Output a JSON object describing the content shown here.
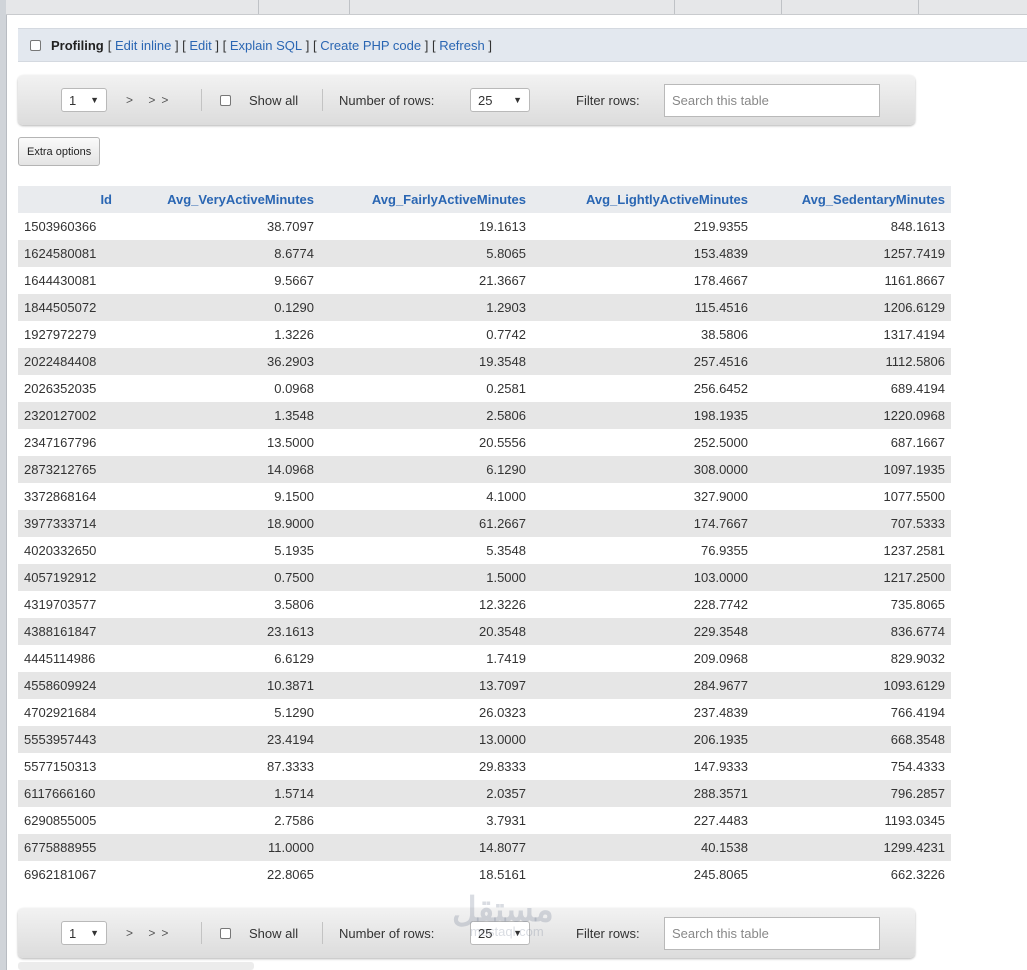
{
  "profiling": {
    "label": "Profiling",
    "links": [
      "Edit inline",
      "Edit",
      "Explain SQL",
      "Create PHP code",
      "Refresh"
    ]
  },
  "nav_top": {
    "page_value": "1",
    "arrows": "> >>",
    "show_all_label": "Show all",
    "rows_label": "Number of rows:",
    "rows_value": "25",
    "filter_label": "Filter rows:",
    "search_placeholder": "Search this table"
  },
  "nav_bottom": {
    "page_value": "1",
    "arrows": "> >>",
    "show_all_label": "Show all",
    "rows_label": "Number of rows:",
    "rows_value": "25",
    "filter_label": "Filter rows:",
    "search_placeholder": "Search this table"
  },
  "extra_options_label": "Extra options",
  "table": {
    "columns": [
      "Id",
      "Avg_VeryActiveMinutes",
      "Avg_FairlyActiveMinutes",
      "Avg_LightlyActiveMinutes",
      "Avg_SedentaryMinutes"
    ],
    "rows": [
      [
        "1503960366",
        "38.7097",
        "19.1613",
        "219.9355",
        "848.1613"
      ],
      [
        "1624580081",
        "8.6774",
        "5.8065",
        "153.4839",
        "1257.7419"
      ],
      [
        "1644430081",
        "9.5667",
        "21.3667",
        "178.4667",
        "1161.8667"
      ],
      [
        "1844505072",
        "0.1290",
        "1.2903",
        "115.4516",
        "1206.6129"
      ],
      [
        "1927972279",
        "1.3226",
        "0.7742",
        "38.5806",
        "1317.4194"
      ],
      [
        "2022484408",
        "36.2903",
        "19.3548",
        "257.4516",
        "1112.5806"
      ],
      [
        "2026352035",
        "0.0968",
        "0.2581",
        "256.6452",
        "689.4194"
      ],
      [
        "2320127002",
        "1.3548",
        "2.5806",
        "198.1935",
        "1220.0968"
      ],
      [
        "2347167796",
        "13.5000",
        "20.5556",
        "252.5000",
        "687.1667"
      ],
      [
        "2873212765",
        "14.0968",
        "6.1290",
        "308.0000",
        "1097.1935"
      ],
      [
        "3372868164",
        "9.1500",
        "4.1000",
        "327.9000",
        "1077.5500"
      ],
      [
        "3977333714",
        "18.9000",
        "61.2667",
        "174.7667",
        "707.5333"
      ],
      [
        "4020332650",
        "5.1935",
        "5.3548",
        "76.9355",
        "1237.2581"
      ],
      [
        "4057192912",
        "0.7500",
        "1.5000",
        "103.0000",
        "1217.2500"
      ],
      [
        "4319703577",
        "3.5806",
        "12.3226",
        "228.7742",
        "735.8065"
      ],
      [
        "4388161847",
        "23.1613",
        "20.3548",
        "229.3548",
        "836.6774"
      ],
      [
        "4445114986",
        "6.6129",
        "1.7419",
        "209.0968",
        "829.9032"
      ],
      [
        "4558609924",
        "10.3871",
        "13.7097",
        "284.9677",
        "1093.6129"
      ],
      [
        "4702921684",
        "5.1290",
        "26.0323",
        "237.4839",
        "766.4194"
      ],
      [
        "5553957443",
        "23.4194",
        "13.0000",
        "206.1935",
        "668.3548"
      ],
      [
        "5577150313",
        "87.3333",
        "29.8333",
        "147.9333",
        "754.4333"
      ],
      [
        "6117666160",
        "1.5714",
        "2.0357",
        "288.3571",
        "796.2857"
      ],
      [
        "6290855005",
        "2.7586",
        "3.7931",
        "227.4483",
        "1193.0345"
      ],
      [
        "6775888955",
        "11.0000",
        "14.8077",
        "40.1538",
        "1299.4231"
      ],
      [
        "6962181067",
        "22.8065",
        "18.5161",
        "245.8065",
        "662.3226"
      ]
    ]
  },
  "watermark": {
    "big": "مستقل",
    "small": "mostaql.com"
  }
}
